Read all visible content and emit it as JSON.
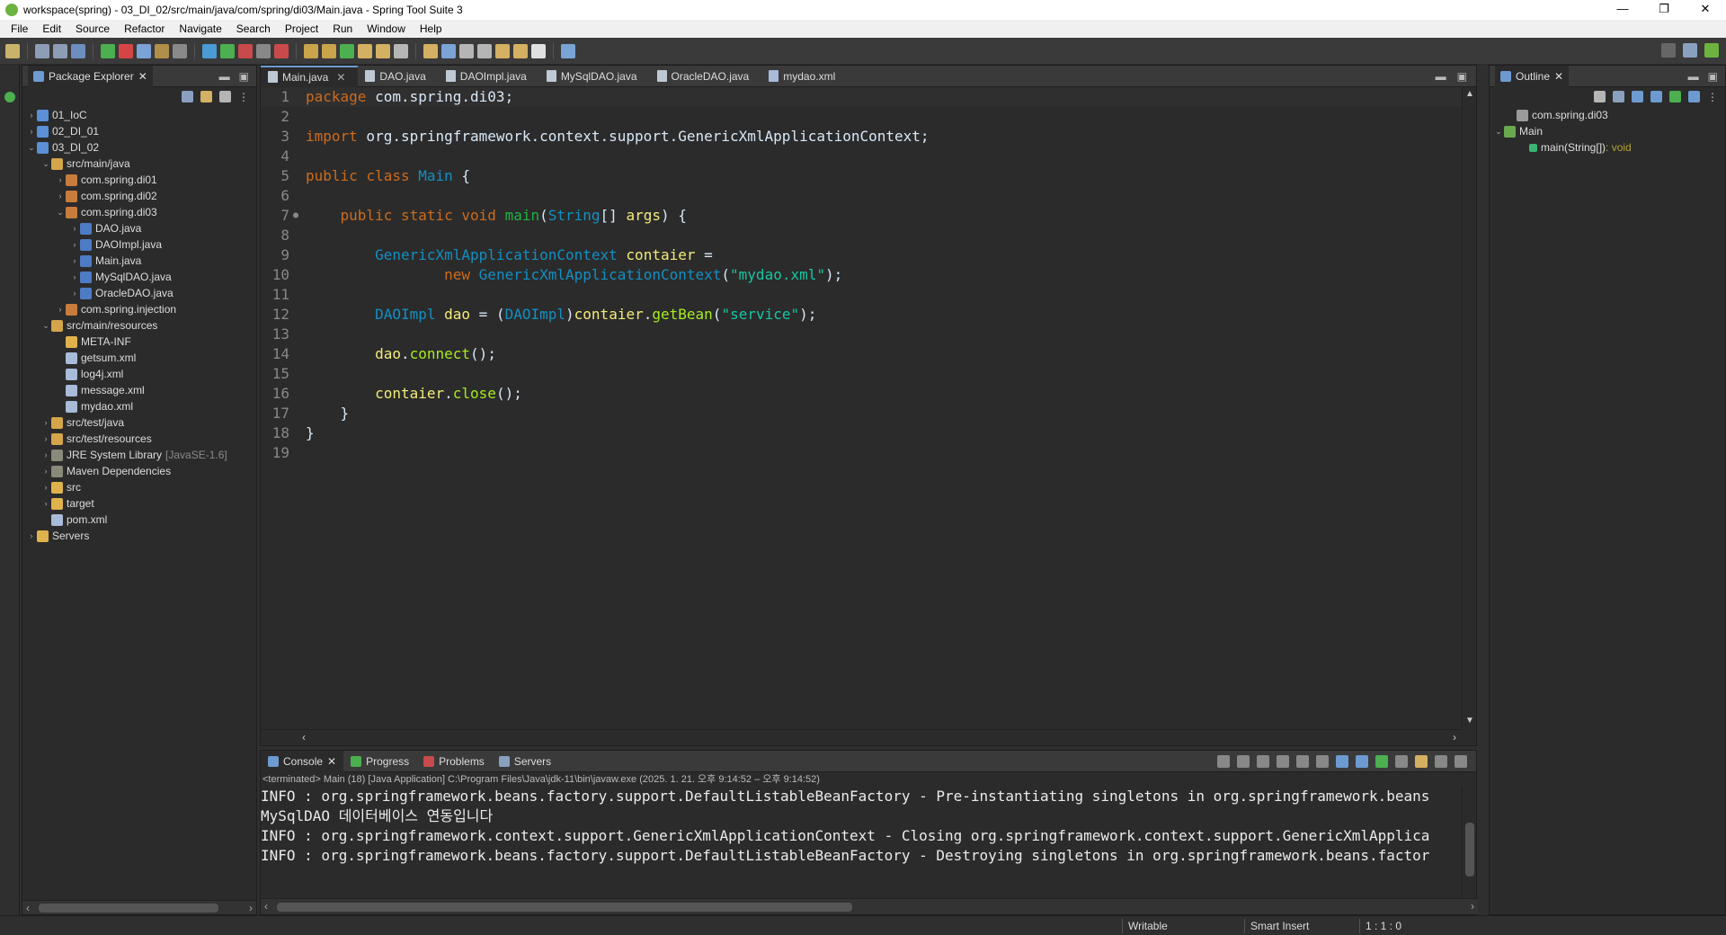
{
  "window": {
    "title": "workspace(spring) - 03_DI_02/src/main/java/com/spring/di03/Main.java - Spring Tool Suite 3",
    "minimize": "—",
    "maximize": "❐",
    "close": "✕"
  },
  "menu": [
    "File",
    "Edit",
    "Source",
    "Refactor",
    "Navigate",
    "Search",
    "Project",
    "Run",
    "Window",
    "Help"
  ],
  "package_explorer": {
    "tab_label": "Package Explorer",
    "tree": [
      {
        "label": "01_IoC",
        "depth": 0,
        "arrow": "›",
        "icon": "project-icon"
      },
      {
        "label": "02_DI_01",
        "depth": 0,
        "arrow": "›",
        "icon": "project-icon"
      },
      {
        "label": "03_DI_02",
        "depth": 0,
        "arrow": "⌄",
        "icon": "project-icon"
      },
      {
        "label": "src/main/java",
        "depth": 1,
        "arrow": "⌄",
        "icon": "source-folder-icon"
      },
      {
        "label": "com.spring.di01",
        "depth": 2,
        "arrow": "›",
        "icon": "package-icon"
      },
      {
        "label": "com.spring.di02",
        "depth": 2,
        "arrow": "›",
        "icon": "package-icon"
      },
      {
        "label": "com.spring.di03",
        "depth": 2,
        "arrow": "⌄",
        "icon": "package-icon"
      },
      {
        "label": "DAO.java",
        "depth": 3,
        "arrow": "›",
        "icon": "java-file-icon"
      },
      {
        "label": "DAOImpl.java",
        "depth": 3,
        "arrow": "›",
        "icon": "java-file-icon"
      },
      {
        "label": "Main.java",
        "depth": 3,
        "arrow": "›",
        "icon": "java-file-icon"
      },
      {
        "label": "MySqlDAO.java",
        "depth": 3,
        "arrow": "›",
        "icon": "java-file-icon"
      },
      {
        "label": "OracleDAO.java",
        "depth": 3,
        "arrow": "›",
        "icon": "java-file-icon"
      },
      {
        "label": "com.spring.injection",
        "depth": 2,
        "arrow": "›",
        "icon": "package-icon"
      },
      {
        "label": "src/main/resources",
        "depth": 1,
        "arrow": "⌄",
        "icon": "source-folder-icon"
      },
      {
        "label": "META-INF",
        "depth": 2,
        "arrow": "",
        "icon": "folder-icon"
      },
      {
        "label": "getsum.xml",
        "depth": 2,
        "arrow": "",
        "icon": "xml-file-icon"
      },
      {
        "label": "log4j.xml",
        "depth": 2,
        "arrow": "",
        "icon": "xml-file-icon"
      },
      {
        "label": "message.xml",
        "depth": 2,
        "arrow": "",
        "icon": "xml-file-icon"
      },
      {
        "label": "mydao.xml",
        "depth": 2,
        "arrow": "",
        "icon": "xml-file-icon"
      },
      {
        "label": "src/test/java",
        "depth": 1,
        "arrow": "›",
        "icon": "source-folder-icon"
      },
      {
        "label": "src/test/resources",
        "depth": 1,
        "arrow": "›",
        "icon": "source-folder-icon"
      },
      {
        "label": "JRE System Library",
        "deco": "[JavaSE-1.6]",
        "depth": 1,
        "arrow": "›",
        "icon": "library-icon"
      },
      {
        "label": "Maven Dependencies",
        "depth": 1,
        "arrow": "›",
        "icon": "library-icon"
      },
      {
        "label": "src",
        "depth": 1,
        "arrow": "›",
        "icon": "folder-icon"
      },
      {
        "label": "target",
        "depth": 1,
        "arrow": "›",
        "icon": "folder-icon"
      },
      {
        "label": "pom.xml",
        "depth": 1,
        "arrow": "",
        "icon": "xml-file-icon"
      },
      {
        "label": "Servers",
        "depth": 0,
        "arrow": "›",
        "icon": "folder-icon"
      }
    ]
  },
  "editor": {
    "tabs": [
      "Main.java",
      "DAO.java",
      "DAOImpl.java",
      "MySqlDAO.java",
      "OracleDAO.java",
      "mydao.xml"
    ],
    "active_tab": "Main.java",
    "line_numbers": [
      "1",
      "2",
      "3",
      "4",
      "5",
      "6",
      "7",
      "8",
      "9",
      "10",
      "11",
      "12",
      "13",
      "14",
      "15",
      "16",
      "17",
      "18",
      "19"
    ],
    "lines": [
      [
        [
          "kw",
          "package"
        ],
        [
          "pl",
          " com.spring.di03;"
        ]
      ],
      [],
      [
        [
          "kw",
          "import"
        ],
        [
          "pl",
          " org.springframework.context.support.GenericXmlApplicationContext;"
        ]
      ],
      [],
      [
        [
          "kw",
          "public"
        ],
        [
          "pl",
          " "
        ],
        [
          "kw",
          "class"
        ],
        [
          "pl",
          " "
        ],
        [
          "ty",
          "Main"
        ],
        [
          "pl",
          " {"
        ]
      ],
      [],
      [
        [
          "pl",
          "    "
        ],
        [
          "kw",
          "public"
        ],
        [
          "pl",
          " "
        ],
        [
          "kw",
          "static"
        ],
        [
          "pl",
          " "
        ],
        [
          "kw",
          "void"
        ],
        [
          "pl",
          " "
        ],
        [
          "meth2",
          "main"
        ],
        [
          "pl",
          "("
        ],
        [
          "ty",
          "String"
        ],
        [
          "pl",
          "[] "
        ],
        [
          "var",
          "args"
        ],
        [
          "pl",
          ") {"
        ]
      ],
      [],
      [
        [
          "pl",
          "        "
        ],
        [
          "ty",
          "GenericXmlApplicationContext"
        ],
        [
          "pl",
          " "
        ],
        [
          "var",
          "contaier"
        ],
        [
          "pl",
          " ="
        ]
      ],
      [
        [
          "pl",
          "                "
        ],
        [
          "kw",
          "new"
        ],
        [
          "pl",
          " "
        ],
        [
          "ty",
          "GenericXmlApplicationContext"
        ],
        [
          "pl",
          "("
        ],
        [
          "str",
          "\"mydao.xml\""
        ],
        [
          "pl",
          ");"
        ]
      ],
      [],
      [
        [
          "pl",
          "        "
        ],
        [
          "ty",
          "DAOImpl"
        ],
        [
          "pl",
          " "
        ],
        [
          "var",
          "dao"
        ],
        [
          "pl",
          " = ("
        ],
        [
          "ty",
          "DAOImpl"
        ],
        [
          "pl",
          ")"
        ],
        [
          "var",
          "contaier"
        ],
        [
          "pl",
          "."
        ],
        [
          "mth",
          "getBean"
        ],
        [
          "pl",
          "("
        ],
        [
          "str",
          "\"service\""
        ],
        [
          "pl",
          ");"
        ]
      ],
      [],
      [
        [
          "pl",
          "        "
        ],
        [
          "var",
          "dao"
        ],
        [
          "pl",
          "."
        ],
        [
          "mth",
          "connect"
        ],
        [
          "pl",
          "();"
        ]
      ],
      [],
      [
        [
          "pl",
          "        "
        ],
        [
          "var",
          "contaier"
        ],
        [
          "pl",
          "."
        ],
        [
          "mth",
          "close"
        ],
        [
          "pl",
          "();"
        ]
      ],
      [
        [
          "pl",
          "    }"
        ]
      ],
      [
        [
          "pl",
          "}"
        ]
      ],
      []
    ]
  },
  "outline": {
    "tab_label": "Outline",
    "items": [
      {
        "label": "com.spring.di03",
        "depth": 1,
        "arrow": "",
        "icon": "import-icon"
      },
      {
        "label": "Main",
        "depth": 0,
        "arrow": "⌄",
        "icon": "class-icon"
      },
      {
        "label": "main(String[])",
        "ret": " : void",
        "depth": 2,
        "arrow": "",
        "icon": "method-icon"
      }
    ]
  },
  "console": {
    "tabs": [
      "Console",
      "Progress",
      "Problems",
      "Servers"
    ],
    "status": "<terminated> Main (18) [Java Application] C:\\Program Files\\Java\\jdk-11\\bin\\javaw.exe  (2025. 1. 21. 오후 9:14:52 – 오후 9:14:52)",
    "lines": [
      "INFO : org.springframework.beans.factory.support.DefaultListableBeanFactory - Pre-instantiating singletons in org.springframework.beans",
      "MySqlDAO 데이터베이스 연동입니다",
      "INFO : org.springframework.context.support.GenericXmlApplicationContext - Closing org.springframework.context.support.GenericXmlApplica",
      "INFO : org.springframework.beans.factory.support.DefaultListableBeanFactory - Destroying singletons in org.springframework.beans.factor"
    ]
  },
  "statusbar": {
    "writable": "Writable",
    "insert_mode": "Smart Insert",
    "position": "1 : 1 : 0"
  }
}
